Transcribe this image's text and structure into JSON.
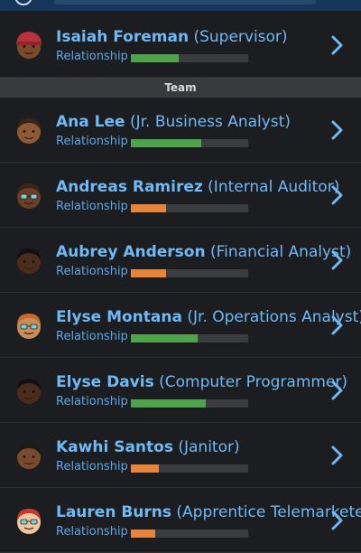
{
  "supervisor": {
    "name": "Isaiah Foreman",
    "role": "(Supervisor)",
    "relationship_label": "Relationship",
    "relationship_level": 0.41,
    "bar_color": "#4fa34a"
  },
  "team_header": "Team",
  "team": [
    {
      "name": "Ana Lee",
      "role": "(Jr. Business Analyst)",
      "relationship_label": "Relationship",
      "relationship_level": 0.6,
      "bar_color": "#4fa34a"
    },
    {
      "name": "Andreas Ramirez",
      "role": "(Internal Auditor)",
      "relationship_label": "Relationship",
      "relationship_level": 0.3,
      "bar_color": "#e8843a"
    },
    {
      "name": "Aubrey Anderson",
      "role": "(Financial Analyst)",
      "relationship_label": "Relationship",
      "relationship_level": 0.3,
      "bar_color": "#e8843a"
    },
    {
      "name": "Elyse Montana",
      "role": "(Jr. Operations Analyst)",
      "relationship_label": "Relationship",
      "relationship_level": 0.57,
      "bar_color": "#4fa34a"
    },
    {
      "name": "Elyse Davis",
      "role": "(Computer Programmer)",
      "relationship_label": "Relationship",
      "relationship_level": 0.64,
      "bar_color": "#4fa34a"
    },
    {
      "name": "Kawhi Santos",
      "role": "(Janitor)",
      "relationship_label": "Relationship",
      "relationship_level": 0.24,
      "bar_color": "#e8843a"
    },
    {
      "name": "Lauren Burns",
      "role": "(Apprentice Telemarketer)",
      "relationship_label": "Relationship",
      "relationship_level": 0.21,
      "bar_color": "#e8843a"
    }
  ],
  "colors": {
    "name_blue": "#6fb9f5",
    "background": "#1c1d20",
    "section_bg": "#393a3e",
    "good": "#4fa34a",
    "poor": "#e8843a"
  },
  "icons": {
    "row_action": "chevron-right-icon",
    "avatar": "avatar-icon"
  }
}
